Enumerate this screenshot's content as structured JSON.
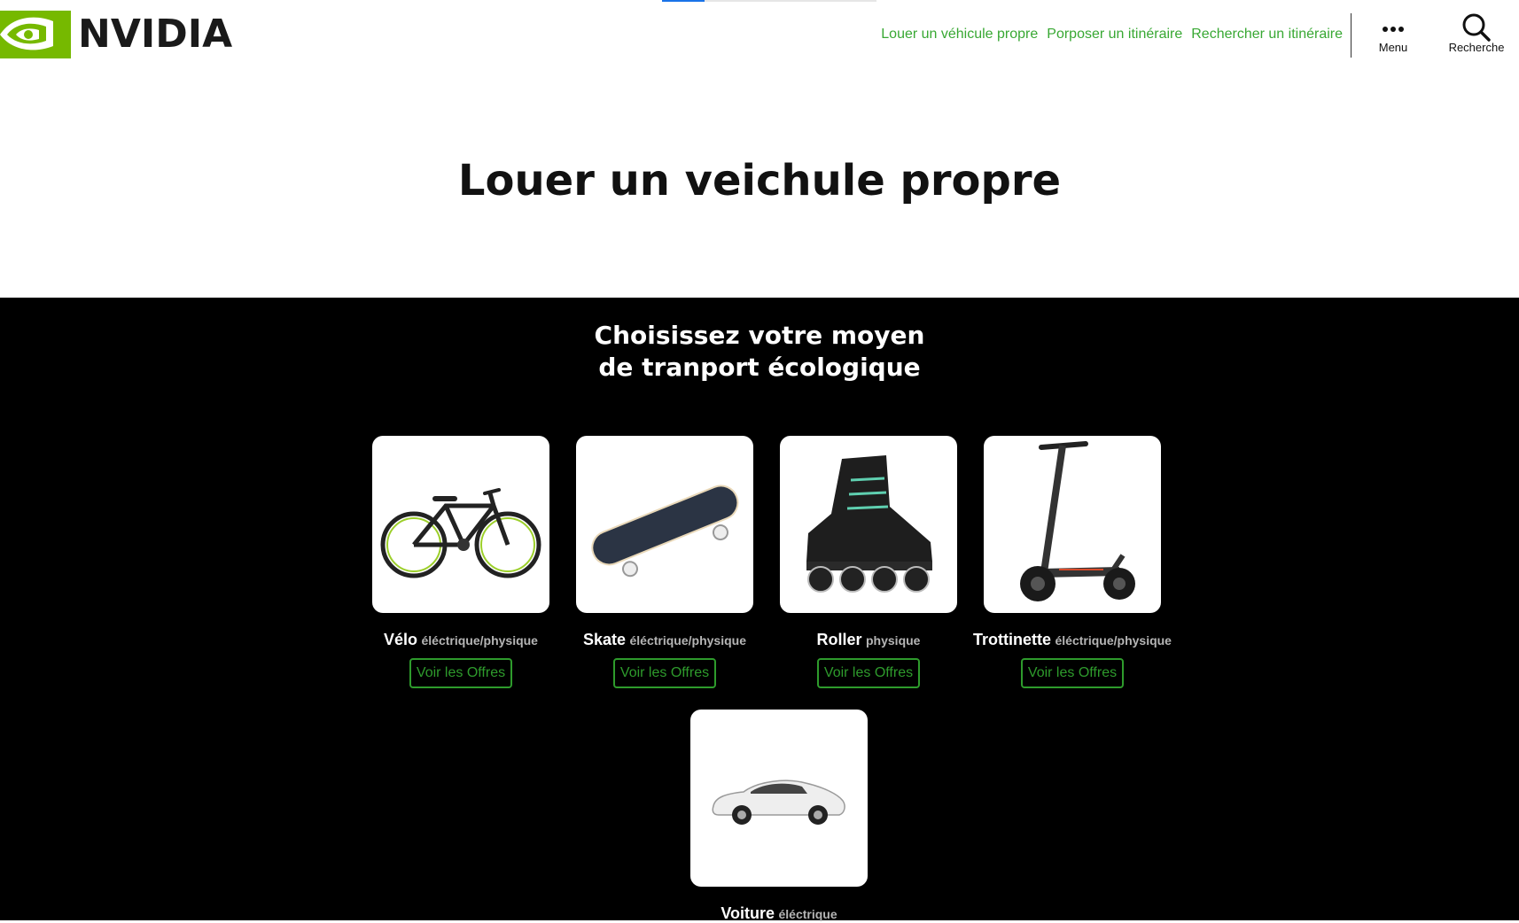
{
  "header": {
    "logo_text": "NVIDIA",
    "nav": [
      {
        "label": "Louer un véhicule propre"
      },
      {
        "label": "Porposer un itinéraire"
      },
      {
        "label": "Rechercher un itinéraire"
      }
    ],
    "menu_label": "Menu",
    "search_label": "Recherche",
    "scroll_progress": 0.2
  },
  "hero": {
    "title": "Louer un veichule propre"
  },
  "section": {
    "title_line1": "Choisissez votre moyen",
    "title_line2": "de tranport écologique",
    "button_label": "Voir les Offres",
    "vehicles": [
      {
        "name": "Vélo",
        "type": "éléctrique/physique",
        "icon": "bicycle-image"
      },
      {
        "name": "Skate",
        "type": "éléctrique/physique",
        "icon": "skateboard-image"
      },
      {
        "name": "Roller",
        "type": "physique",
        "icon": "inline-skate-image"
      },
      {
        "name": "Trottinette",
        "type": "éléctrique/physique",
        "icon": "scooter-image"
      },
      {
        "name": "Voiture",
        "type": "éléctrique",
        "icon": "car-image"
      }
    ]
  },
  "colors": {
    "brand_green": "#76b900",
    "link_green": "#38a833",
    "button_green": "#2e9b2c",
    "dark_bg": "#000000"
  }
}
